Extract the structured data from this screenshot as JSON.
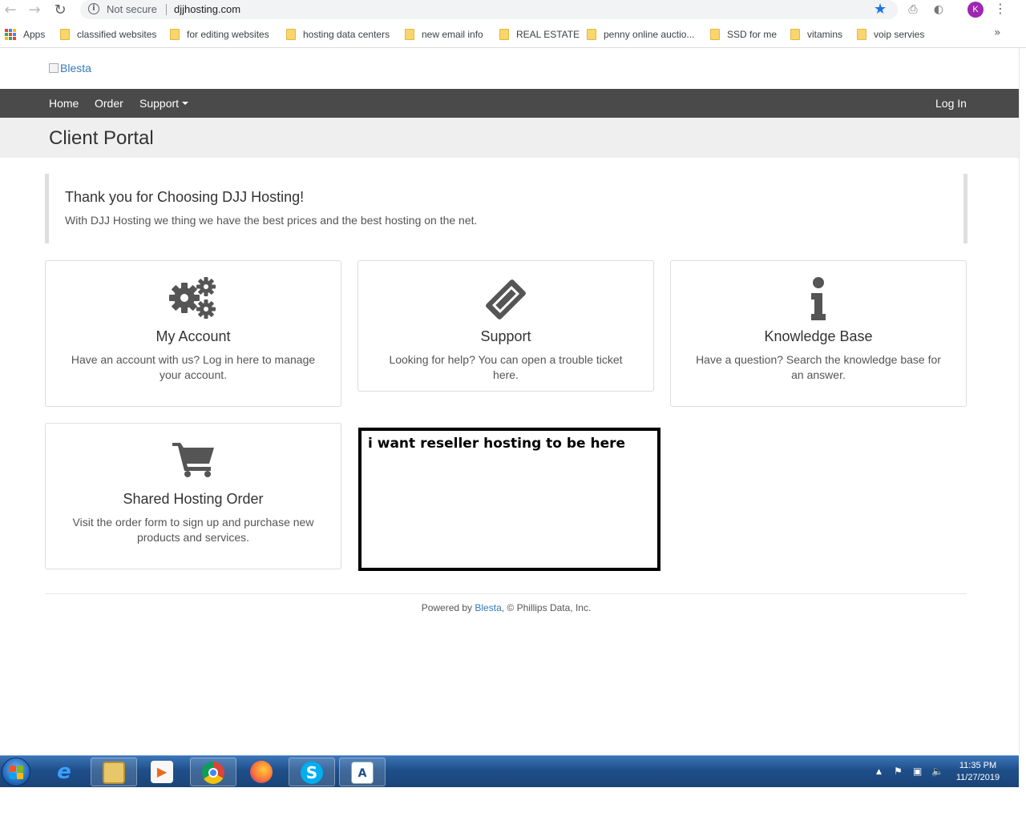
{
  "browser": {
    "security_label": "Not secure",
    "url": "djjhosting.com",
    "profile_initial": "K",
    "bookmarks": [
      "Apps",
      "classified websites",
      "for editing websites",
      "hosting data centers",
      "new email info",
      "REAL ESTATE",
      "penny online auctio...",
      "SSD for me",
      "vitamins",
      "voip servies"
    ]
  },
  "page": {
    "logo_alt": "Blesta",
    "nav": {
      "home": "Home",
      "order": "Order",
      "support": "Support",
      "login": "Log In"
    },
    "title": "Client Portal",
    "callout": {
      "heading": "Thank you for Choosing DJJ Hosting!",
      "text": "With DJJ Hosting we thing we have the best prices and the best hosting on the net."
    },
    "cards": [
      {
        "title": "My Account",
        "text": "Have an account with us? Log in here to manage your account.",
        "icon": "gears-icon"
      },
      {
        "title": "Support",
        "text": "Looking for help? You can open a trouble ticket here.",
        "icon": "ticket-icon"
      },
      {
        "title": "Knowledge Base",
        "text": "Have a question? Search the knowledge base for an answer.",
        "icon": "info-icon"
      },
      {
        "title": "Shared Hosting Order",
        "text": "Visit the order form to sign up and purchase new products and services.",
        "icon": "cart-icon"
      }
    ],
    "annotation": "i want reseller hosting to be here",
    "footer": {
      "prefix": "Powered by ",
      "link": "Blesta",
      "suffix": ", © Phillips Data, Inc."
    }
  },
  "taskbar": {
    "time": "11:35 PM",
    "date": "11/27/2019"
  },
  "colors": {
    "navbar": "#4a4a4a",
    "link": "#337ab7",
    "icon": "#555555",
    "taskbar": "#1f4f8a"
  }
}
